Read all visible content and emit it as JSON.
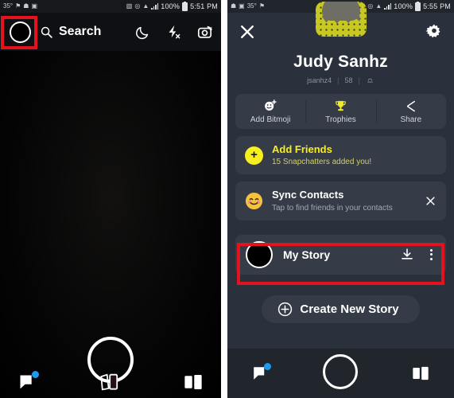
{
  "left_screen": {
    "status_bar": {
      "temperature": "35°",
      "battery_percent": "100%",
      "time": "5:51 PM",
      "icons": [
        "flag-icon",
        "snapchat-icon",
        "message-icon",
        "mute-icon",
        "alarm-icon",
        "wifi-icon",
        "signal-icon",
        "battery-icon"
      ]
    },
    "header": {
      "profile_avatar": "profile-avatar",
      "search_label": "Search",
      "search_icon": "search-icon",
      "night_mode_icon": "moon-icon",
      "flash_icon": "flash-off-icon",
      "flip_camera_icon": "camera-flip-icon"
    },
    "camera": {
      "shutter": "shutter-button"
    },
    "bottom_nav": {
      "chat_icon": "chat-bubble-icon",
      "chat_badge": true,
      "memories_icon": "memories-cards-icon",
      "discover_icon": "discover-book-icon"
    }
  },
  "right_screen": {
    "status_bar": {
      "temperature": "35°",
      "battery_percent": "100%",
      "time": "5:55 PM",
      "icons": [
        "snapchat-icon",
        "message-icon",
        "flag-icon",
        "mute-icon",
        "alarm-icon",
        "wifi-icon",
        "signal-icon",
        "battery-icon"
      ]
    },
    "header": {
      "close_icon": "close-x-icon",
      "settings_icon": "gear-icon",
      "snapcode": "snapcode-ghost"
    },
    "profile": {
      "display_name": "Judy Sanhz",
      "username": "jsanhz4",
      "snap_score": "58",
      "zodiac_icon": "zodiac-icon"
    },
    "actions": [
      {
        "label": "Add Bitmoji",
        "icon": "add-bitmoji-icon"
      },
      {
        "label": "Trophies",
        "icon": "trophy-icon"
      },
      {
        "label": "Share",
        "icon": "share-icon"
      }
    ],
    "add_friends": {
      "title": "Add Friends",
      "subtitle": "15 Snapchatters added you!",
      "icon": "plus-circle-icon"
    },
    "sync_contacts": {
      "title": "Sync Contacts",
      "subtitle": "Tap to find friends in your contacts",
      "icon": "blush-smiley-icon",
      "dismiss_icon": "close-x-icon"
    },
    "my_story": {
      "title": "My Story",
      "avatar": "story-avatar",
      "download_icon": "download-icon",
      "more_icon": "more-vertical-icon",
      "highlighted": true
    },
    "create_story": {
      "label": "Create New Story",
      "icon": "plus-circle-outline-icon"
    },
    "bottom_nav": {
      "chat_icon": "chat-bubble-icon",
      "chat_badge": true,
      "shutter": "shutter-button",
      "discover_icon": "discover-book-icon"
    }
  },
  "annotations": {
    "highlight_color": "#e4121c",
    "accent_yellow": "#f7f01e",
    "badge_blue": "#1d9bf0"
  }
}
